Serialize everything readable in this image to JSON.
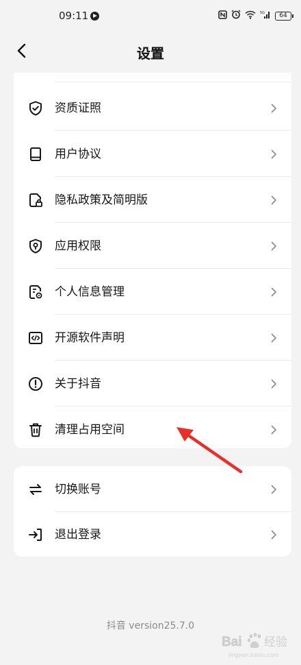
{
  "status_bar": {
    "time": "09:11",
    "battery": "64"
  },
  "header": {
    "title": "设置"
  },
  "menu_group_1": [
    {
      "label": "资质证照",
      "icon": "shield-check-icon"
    },
    {
      "label": "用户协议",
      "icon": "book-icon"
    },
    {
      "label": "隐私政策及简明版",
      "icon": "document-lock-icon"
    },
    {
      "label": "应用权限",
      "icon": "shield-location-icon"
    },
    {
      "label": "个人信息管理",
      "icon": "document-gear-icon"
    },
    {
      "label": "开源软件声明",
      "icon": "code-icon"
    },
    {
      "label": "关于抖音",
      "icon": "info-circle-icon"
    },
    {
      "label": "清理占用空间",
      "icon": "trash-icon"
    }
  ],
  "menu_group_2": [
    {
      "label": "切换账号",
      "icon": "swap-icon"
    },
    {
      "label": "退出登录",
      "icon": "logout-icon"
    }
  ],
  "footer": {
    "version": "抖音 version25.7.0"
  },
  "annotation": {
    "arrow_color": "#e8302a"
  },
  "watermark": {
    "text": "Bai 经验",
    "sub": "jingyan.baidu.com"
  }
}
